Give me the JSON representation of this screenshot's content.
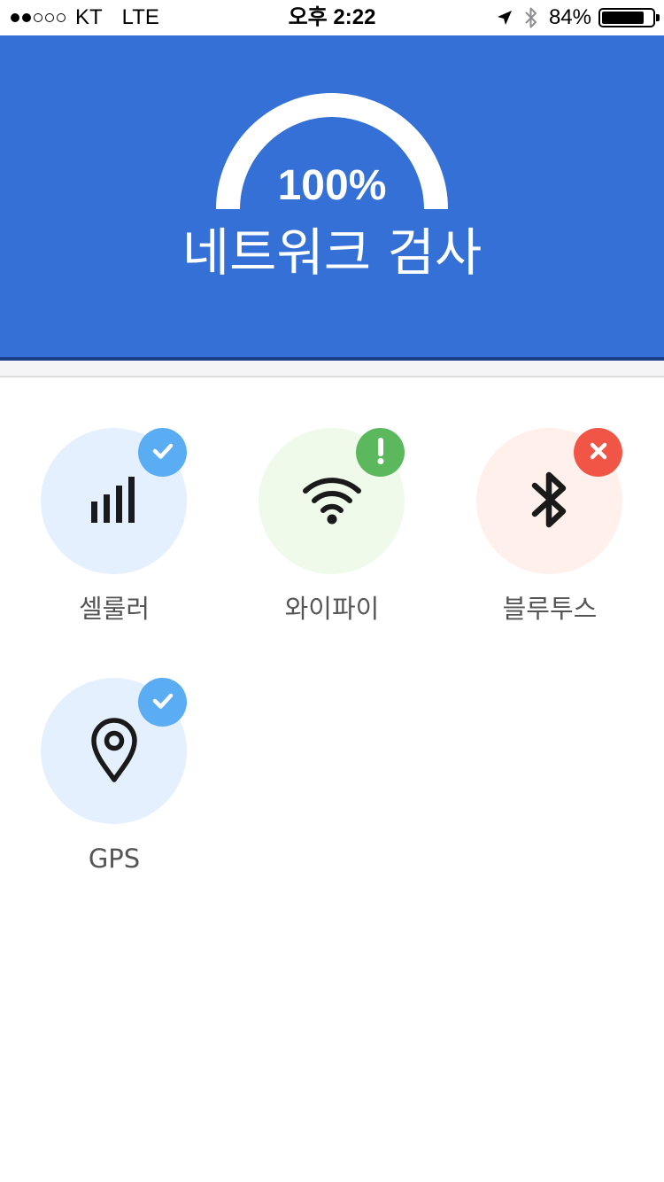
{
  "status_bar": {
    "carrier": "KT",
    "network": "LTE",
    "time": "오후 2:22",
    "battery_percent": "84%",
    "battery_level": 0.84,
    "signal_bars_filled": 2,
    "signal_bars_total": 5,
    "icons": [
      "location-arrow-icon",
      "bluetooth-icon",
      "battery-icon"
    ]
  },
  "header": {
    "percent": "100%",
    "progress": 1.0,
    "title": "네트워크 검사",
    "background_color": "#3470d5"
  },
  "items": [
    {
      "label": "셀룰러",
      "icon": "cellular-signal-icon",
      "status": "ok",
      "badge_icon": "check-icon"
    },
    {
      "label": "와이파이",
      "icon": "wifi-icon",
      "status": "warning",
      "badge_icon": "exclamation-icon"
    },
    {
      "label": "블루투스",
      "icon": "bluetooth-icon",
      "status": "error",
      "badge_icon": "close-icon"
    },
    {
      "label": "GPS",
      "icon": "location-pin-icon",
      "status": "ok",
      "badge_icon": "check-icon"
    }
  ],
  "colors": {
    "ok": "#5aadf2",
    "warning": "#5cb85c",
    "error": "#f05545"
  }
}
